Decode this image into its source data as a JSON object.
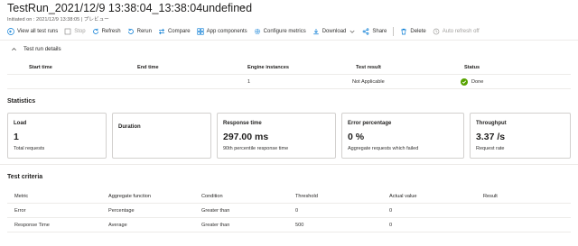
{
  "header": {
    "title": "TestRun_2021/12/9 13:38:04_13:38:04undefined",
    "more": "···",
    "subtitle": "Initiated on : 2021/12/9 13:38:05 | プレビュー"
  },
  "toolbar": {
    "items": [
      {
        "label": "View all test runs",
        "icon": "back-arrow-icon"
      },
      {
        "label": "Stop",
        "icon": "stop-icon",
        "disabled": true
      },
      {
        "label": "Refresh",
        "icon": "refresh-icon"
      },
      {
        "label": "Rerun",
        "icon": "rerun-icon"
      },
      {
        "label": "Compare",
        "icon": "compare-icon"
      },
      {
        "label": "App components",
        "icon": "app-components-icon"
      },
      {
        "label": "Configure metrics",
        "icon": "gear-icon"
      },
      {
        "label": "Download",
        "icon": "download-icon"
      },
      {
        "label": "Share",
        "icon": "share-icon"
      },
      {
        "label": "Delete",
        "icon": "delete-icon"
      },
      {
        "label": "Auto refresh off",
        "icon": "auto-refresh-icon",
        "disabled": true
      }
    ]
  },
  "details": {
    "title": "Test run details",
    "columns": [
      "Start time",
      "End time",
      "Engine instances",
      "Test result",
      "Status"
    ],
    "row": {
      "start_time": "",
      "end_time": "",
      "engine_instances": "1",
      "test_result": "Not Applicable",
      "status": "Done"
    }
  },
  "statistics": {
    "title": "Statistics",
    "cards": [
      {
        "title": "Load",
        "value": "1",
        "sub": "Total requests"
      },
      {
        "title": "Duration",
        "value": "",
        "sub": ""
      },
      {
        "title": "Response time",
        "value": "297.00 ms",
        "sub": "90th percentile response time"
      },
      {
        "title": "Error percentage",
        "value": "0 %",
        "sub": "Aggregate requests which failed"
      },
      {
        "title": "Throughput",
        "value": "3.37 /s",
        "sub": "Request rate"
      }
    ]
  },
  "criteria": {
    "title": "Test criteria",
    "columns": [
      "Metric",
      "Aggregate function",
      "Condition",
      "Threshold",
      "Actual value",
      "Result"
    ],
    "rows": [
      {
        "metric": "Error",
        "aggregate": "Percentage",
        "condition": "Greater than",
        "threshold": "0",
        "actual": "0",
        "result": ""
      },
      {
        "metric": "Response Time",
        "aggregate": "Average",
        "condition": "Greater than",
        "threshold": "500",
        "actual": "0",
        "result": ""
      }
    ]
  },
  "colors": {
    "accent": "#0078d4",
    "success": "#57a300",
    "border": "#d2d0ce",
    "disabled": "#a19f9d"
  }
}
